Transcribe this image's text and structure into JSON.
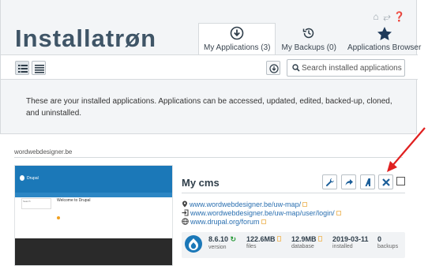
{
  "header": {
    "logo": "Installatrøn",
    "top_icons": [
      "home-icon",
      "fullscreen-icon",
      "help-icon"
    ],
    "tabs": [
      {
        "label": "My Applications (3)",
        "icon": "download-circle-icon",
        "active": true
      },
      {
        "label": "My Backups (0)",
        "icon": "history-icon",
        "active": false
      },
      {
        "label": "Applications Browser",
        "icon": "star-icon",
        "active": false
      }
    ]
  },
  "toolbar": {
    "search_placeholder": "Search installed applications"
  },
  "intro": {
    "text": "These are your installed applications. Applications can be accessed, updated, edited, backed-up, cloned, and uninstalled."
  },
  "section": {
    "label": "wordwebdesigner.be"
  },
  "thumbnail": {
    "site_name": "Drupal",
    "welcome": "Welcome to Drupal",
    "search_label": "Search"
  },
  "app": {
    "title": "My cms",
    "links": [
      {
        "icon": "location-icon",
        "text": "www.wordwebdesigner.be/uw-map/"
      },
      {
        "icon": "login-icon",
        "text": "www.wordwebdesigner.be/uw-map/user/login/"
      },
      {
        "icon": "globe-icon",
        "text": "www.drupal.org/forum"
      }
    ],
    "stats": [
      {
        "value": "8.6.10",
        "label": "version"
      },
      {
        "value": "122.6MB",
        "label": "files"
      },
      {
        "value": "12.9MB",
        "label": "database"
      },
      {
        "value": "2019-03-11",
        "label": "installed"
      },
      {
        "value": "0",
        "label": "backups"
      }
    ]
  },
  "colors": {
    "brand": "#3f5567",
    "accent": "#1b78b8",
    "link": "#2a6fb0",
    "annotation_arrow": "#e02020"
  }
}
